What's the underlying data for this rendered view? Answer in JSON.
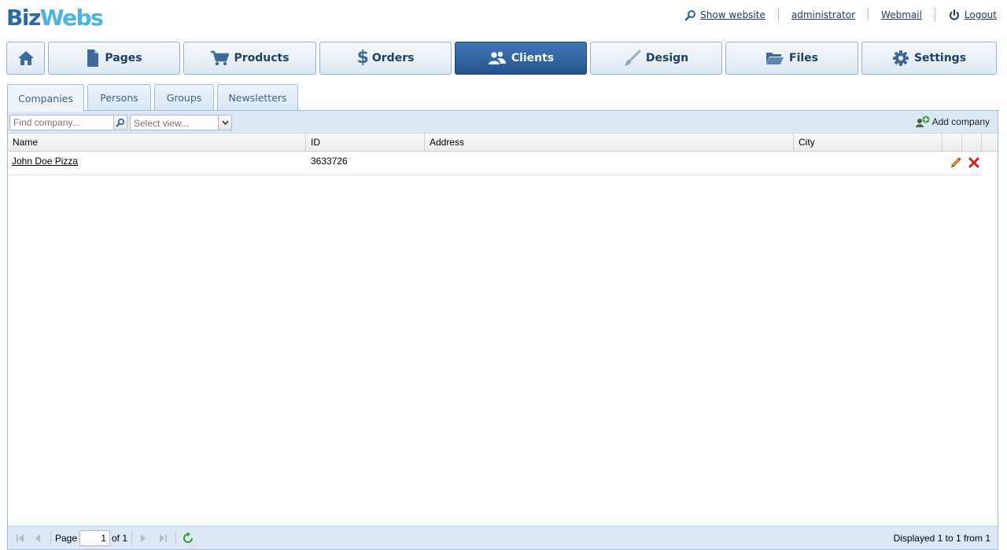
{
  "header": {
    "logo_part1": "Biz",
    "logo_part2": "Webs",
    "links": [
      {
        "label": "Show website",
        "icon": "search-icon"
      },
      {
        "label": "administrator"
      },
      {
        "label": "Webmail"
      },
      {
        "label": "Logout",
        "icon": "power-icon"
      }
    ]
  },
  "nav": {
    "items": [
      {
        "label": "",
        "icon": "home-icon"
      },
      {
        "label": "Pages",
        "icon": "page-icon"
      },
      {
        "label": "Products",
        "icon": "cart-icon"
      },
      {
        "label": "Orders",
        "icon": "dollar-icon"
      },
      {
        "label": "Clients",
        "icon": "users-icon",
        "active": true
      },
      {
        "label": "Design",
        "icon": "brush-icon"
      },
      {
        "label": "Files",
        "icon": "folder-icon"
      },
      {
        "label": "Settings",
        "icon": "gear-icon"
      }
    ]
  },
  "tabs": [
    {
      "label": "Companies",
      "active": true
    },
    {
      "label": "Persons"
    },
    {
      "label": "Groups"
    },
    {
      "label": "Newsletters"
    }
  ],
  "toolbar": {
    "find_placeholder": "Find company...",
    "view_placeholder": "Select view...",
    "add_label": "Add company"
  },
  "grid": {
    "columns": [
      "Name",
      "ID",
      "Address",
      "City"
    ],
    "rows": [
      {
        "name": "John Doe Pizza",
        "id": "3633726",
        "address": "",
        "city": ""
      }
    ]
  },
  "pager": {
    "page_label": "Page",
    "page_value": "1",
    "of_label": "of 1",
    "status": "Displayed 1 to 1 from 1"
  },
  "colors": {
    "accent": "#2a5f9e",
    "nav_active": "#2f65a3",
    "toolbar_bg": "#dbe7f3",
    "delete": "#d6201b",
    "edit": "#e0a526",
    "refresh": "#2f9a2f"
  }
}
